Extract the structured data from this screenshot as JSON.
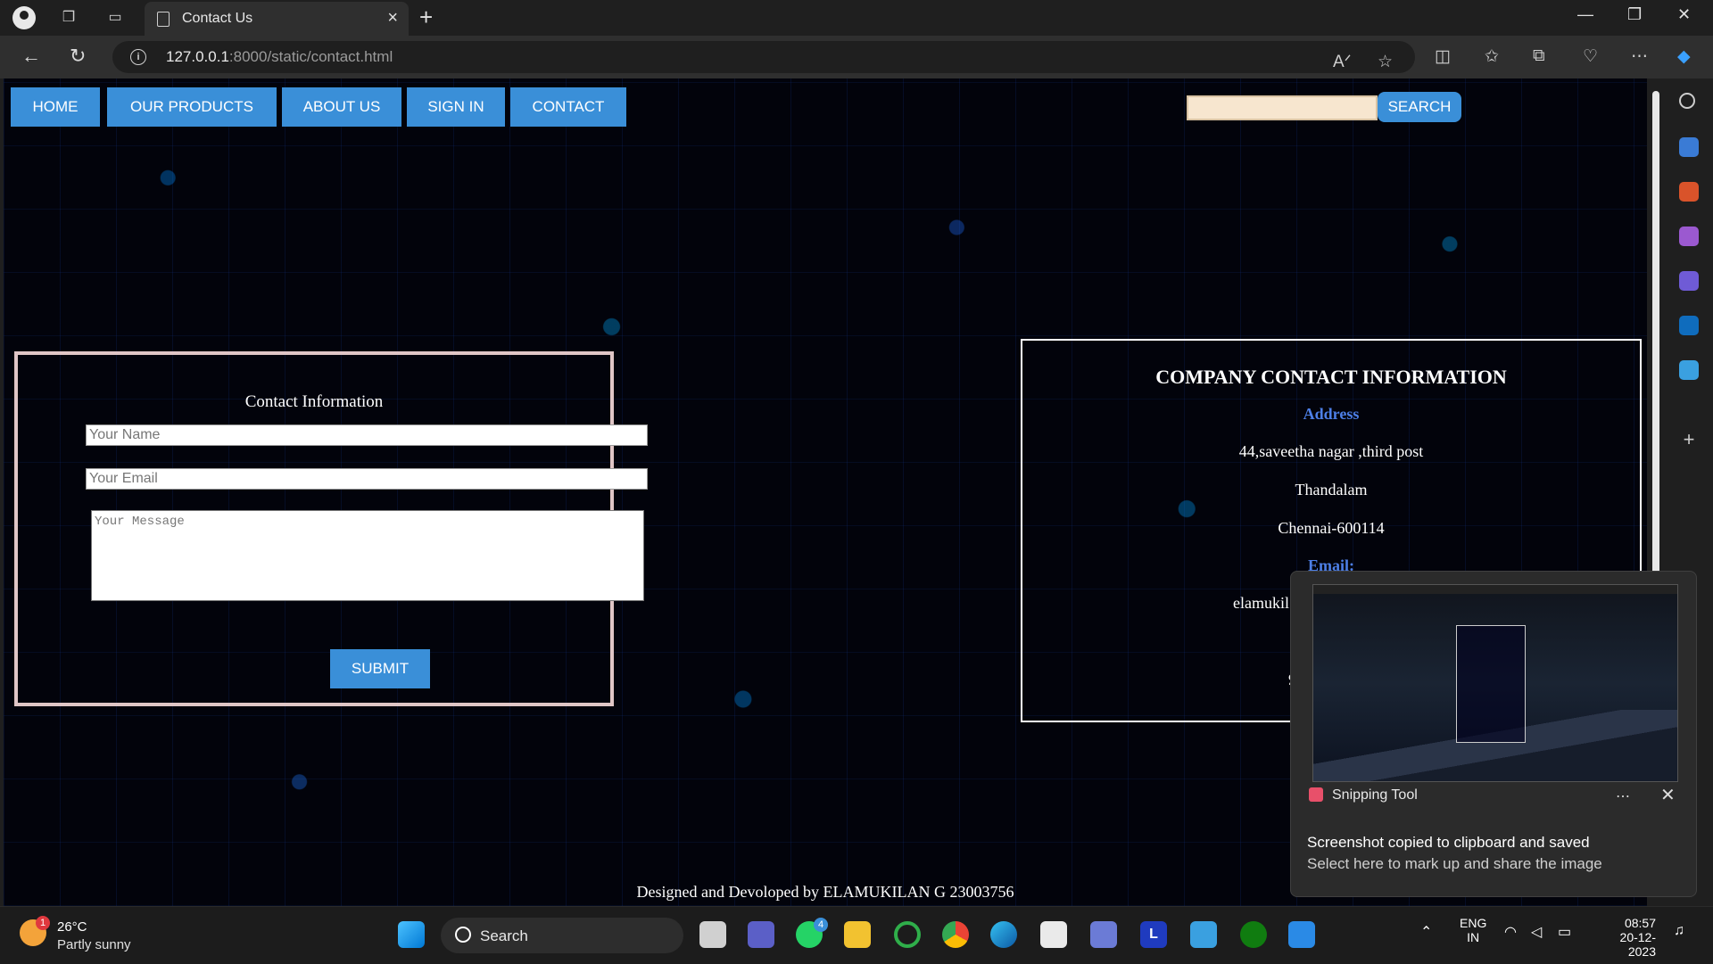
{
  "browser": {
    "tab_title": "Contact Us",
    "url_host": "127.0.0.1",
    "url_path": ":8000/static/contact.html"
  },
  "nav": {
    "items": [
      "HOME",
      "OUR PRODUCTS",
      "ABOUT US",
      "SIGN IN",
      "CONTACT"
    ],
    "search_value": "",
    "search_button": "SEARCH"
  },
  "form": {
    "title": "Contact Information",
    "name_placeholder": "Your Name",
    "email_placeholder": "Your Email",
    "message_placeholder": "Your Message",
    "submit_label": "SUBMIT"
  },
  "company": {
    "title": "COMPANY CONTACT INFORMATION",
    "address_heading": "Address",
    "address_lines": [
      "44,saveetha nagar ,third post",
      "Thandalam",
      "Chennai-600114"
    ],
    "email_heading": "Email:",
    "email_partial": "elamukil",
    "phone_partial": "9"
  },
  "footer": {
    "text": "Designed and Devoloped by ELAMUKILAN G 23003756"
  },
  "toast": {
    "app_name": "Snipping Tool",
    "message_title": "Screenshot copied to clipboard and saved",
    "message_body": "Select here to mark up and share the image"
  },
  "taskbar": {
    "weather_temp": "26°C",
    "weather_desc": "Partly sunny",
    "weather_badge": "1",
    "search_label": "Search",
    "whatsapp_badge": "4",
    "lang_top": "ENG",
    "lang_bottom": "IN",
    "time": "08:57",
    "date": "20-12-2023"
  },
  "colors": {
    "accent": "#3a8fd8",
    "address_heading": "#4d7fe6",
    "form_border": "#e0c6c6"
  }
}
